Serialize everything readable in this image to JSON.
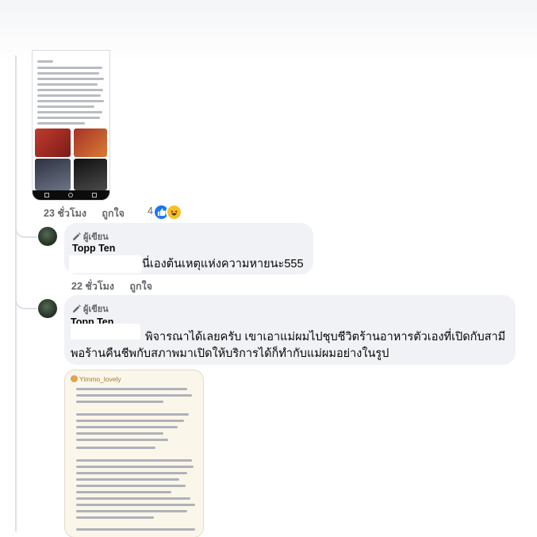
{
  "comment_top": {
    "time": "23 ชั่วโมง",
    "like_label": "ถูกใจ",
    "reaction_count": "4"
  },
  "reply1": {
    "author_badge": "ผู้เขียน",
    "name": "Topp Ten",
    "text": "นี่เองต้นเหตุแห่งความหายนะ555",
    "time": "22 ชั่วโมง",
    "like_label": "ถูกใจ"
  },
  "reply2": {
    "author_badge": "ผู้เขียน",
    "name": "Topp Ten",
    "text_line1": "พิจารณาได้เลยครับ เขาเอาแม่ผมไปชุบชีวิตร้านอาหารตัวเองที่เปิดกับสามี",
    "text_line2": "พอร้านคืนชีพกับสภาพมาเปิดให้บริการได้ก็ทำกับแม่ผมอย่างในรูป"
  },
  "chat_screenshot": {
    "sender": "Yimmo_lovely"
  },
  "colors": {
    "bubble": "#f0f2f5",
    "like_blue": "#1877f2",
    "meta_gray": "#65676b"
  }
}
